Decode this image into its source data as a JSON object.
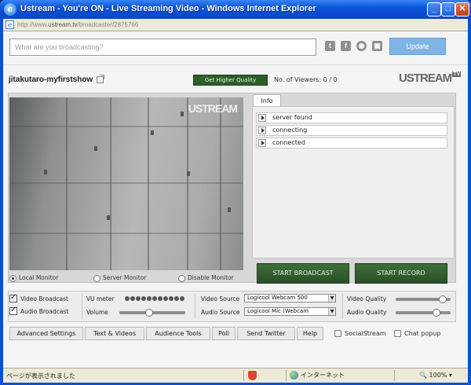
{
  "window": {
    "title": "Ustream - You're ON - Live Streaming Video - Windows Internet Explorer",
    "url_prefix": "http://www.",
    "url_domain": "ustream.tv",
    "url_path": "/broadcaster/2875766",
    "minimize_glyph": "_",
    "maximize_glyph": "□",
    "close_glyph": "✕"
  },
  "broadcast_input": {
    "placeholder": "What are you broadcasting?"
  },
  "social": {
    "twitter": "t",
    "facebook": "f",
    "eye": "◉",
    "square": "▣"
  },
  "update_label": "Update",
  "show": {
    "title": "jitakutaro-myfirstshow",
    "hq_label": "Get Higher Quality",
    "viewers_label": "No. of Viewers: 0 / 0",
    "brand": "USTREAM",
    "brand_tv": "TV"
  },
  "video": {
    "watermark": "USTREAM"
  },
  "monitor": {
    "local": "Local Monitor",
    "server": "Server Monitor",
    "disable": "Disable Monitor",
    "selected": "local"
  },
  "info": {
    "tab_label": "Info",
    "rows": [
      "server found",
      "connecting",
      "connected"
    ]
  },
  "buttons": {
    "start_broadcast": "START BROADCAST",
    "start_record": "START RECORD"
  },
  "controls": {
    "video_broadcast": "Video Broadcast",
    "audio_broadcast": "Audio Broadcast",
    "vu_meter": "VU meter",
    "volume": "Volume",
    "volume_level": 0.45,
    "video_source_label": "Video Source",
    "video_source_value": "Logicool Webcam 500",
    "audio_source_label": "Audio Source",
    "audio_source_value": "Logicool Mic (Webcam",
    "video_quality": "Video Quality",
    "video_quality_level": 0.92,
    "audio_quality": "Audio Quality",
    "audio_quality_level": 0.78
  },
  "tabs": [
    "Advanced Settings",
    "Text & Videos",
    "Audience Tools",
    "Poll",
    "Send Twitter",
    "Help"
  ],
  "links": {
    "social_stream": "SocialStream",
    "chat_popup": "Chat popup"
  },
  "statusbar": {
    "message": "ページが表示されました",
    "zone": "インターネット",
    "zoom": "100%"
  }
}
